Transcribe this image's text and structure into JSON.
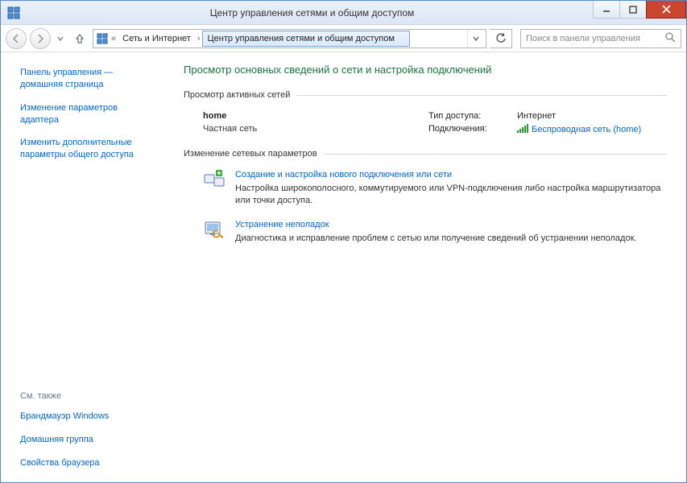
{
  "window": {
    "title": "Центр управления сетями и общим доступом"
  },
  "breadcrumb": {
    "level0": "«",
    "level1": "Сеть и Интернет",
    "level2": "Центр управления сетями и общим доступом"
  },
  "search": {
    "placeholder": "Поиск в панели управления"
  },
  "sidebar": {
    "link_home": "Панель управления — домашняя страница",
    "link_adapter": "Изменение параметров адаптера",
    "link_sharing": "Изменить дополнительные параметры общего доступа",
    "seealso_hdr": "См. также",
    "seealso_firewall": "Брандмауэр Windows",
    "seealso_homegroup": "Домашняя группа",
    "seealso_internet": "Свойства браузера"
  },
  "page": {
    "title": "Просмотр основных сведений о сети и настройка подключений",
    "sec_active": "Просмотр активных сетей",
    "sec_change": "Изменение сетевых параметров"
  },
  "network": {
    "name": "home",
    "type": "Частная сеть",
    "access_label": "Тип доступа:",
    "access_value": "Интернет",
    "conn_label": "Подключения:",
    "conn_link": "Беспроводная сеть (home)"
  },
  "tasks": {
    "new_conn_title": "Создание и настройка нового подключения или сети",
    "new_conn_desc": "Настройка широкополосного, коммутируемого или VPN-подключения либо настройка маршрутизатора или точки доступа.",
    "trouble_title": "Устранение неполадок",
    "trouble_desc": "Диагностика и исправление проблем с сетью или получение сведений об устранении неполадок."
  }
}
